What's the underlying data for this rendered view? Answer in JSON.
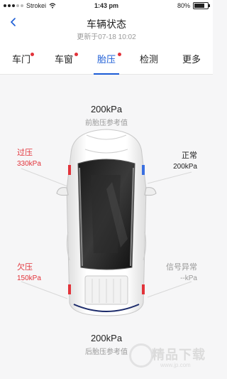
{
  "status_bar": {
    "carrier": "Strokei",
    "time": "1:43 pm",
    "battery": "80%",
    "battery_level": 0.8
  },
  "header": {
    "title": "车辆状态",
    "subtitle": "更新于07-18 10:02"
  },
  "tabs": [
    {
      "label": "车门",
      "active": false,
      "alert": true
    },
    {
      "label": "车窗",
      "active": false,
      "alert": true
    },
    {
      "label": "胎压",
      "active": true,
      "alert": true
    },
    {
      "label": "检测",
      "active": false,
      "alert": false
    },
    {
      "label": "更多",
      "active": false,
      "alert": false
    }
  ],
  "front_reference": {
    "value": "200kPa",
    "label": "前胎压参考值"
  },
  "rear_reference": {
    "value": "200kPa",
    "label": "后胎压参考值"
  },
  "wheels": {
    "front_left": {
      "status": "过压",
      "value": "330kPa",
      "color": "#e2333a"
    },
    "front_right": {
      "status": "正常",
      "value": "200kPa",
      "color": "#222222"
    },
    "rear_left": {
      "status": "欠压",
      "value": "150kPa",
      "color": "#e2333a"
    },
    "rear_right": {
      "status": "信号异常",
      "value": "--kPa",
      "color": "#999999"
    }
  },
  "colors": {
    "accent": "#1b5cd6",
    "alert": "#e2333a",
    "warn_marker": "#e2333a",
    "normal_marker": "#3a6fe0"
  },
  "watermark": {
    "text": "精品下载",
    "url": "www.jp.com"
  }
}
